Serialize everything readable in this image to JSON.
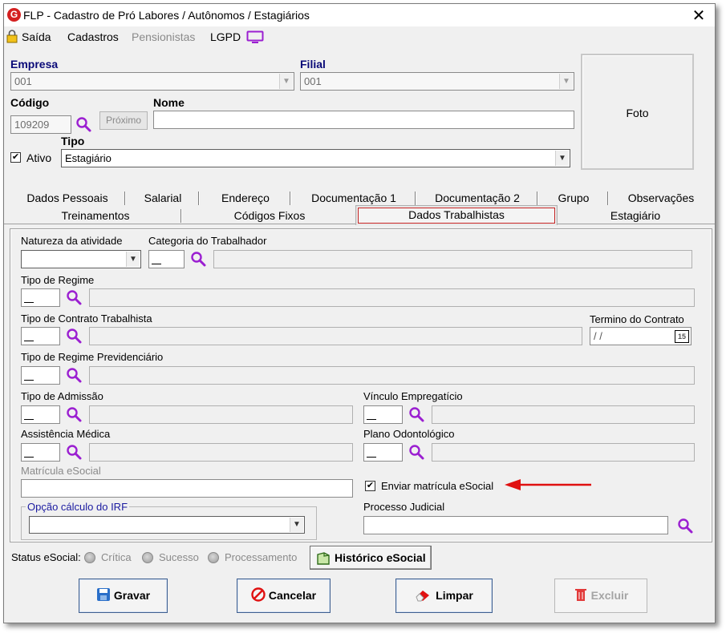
{
  "window": {
    "title": "FLP - Cadastro de Pró Labores / Autônomos / Estagiários",
    "close_label": "✕"
  },
  "menu": {
    "saida": "Saída",
    "cadastros": "Cadastros",
    "pensionistas": "Pensionistas",
    "lgpd": "LGPD"
  },
  "header": {
    "empresa_label": "Empresa",
    "empresa_value": "001",
    "filial_label": "Filial",
    "filial_value": "001",
    "codigo_label": "Código",
    "codigo_value": "109209",
    "proximo_label": "Próximo",
    "nome_label": "Nome",
    "nome_value": "",
    "ativo_label": "Ativo",
    "ativo_checked": true,
    "tipo_label": "Tipo",
    "tipo_value": "Estagiário",
    "foto_label": "Foto"
  },
  "tabs": {
    "row1": [
      "Dados Pessoais",
      "Salarial",
      "Endereço",
      "Documentação 1",
      "Documentação 2",
      "Grupo",
      "Observações"
    ],
    "row2": [
      "Treinamentos",
      "Códigos Fixos",
      "Dados Trabalhistas",
      "Estagiário"
    ],
    "active": "Dados Trabalhistas"
  },
  "form": {
    "natureza_label": "Natureza da atividade",
    "categoria_label": "Categoria do Trabalhador",
    "tipo_regime_label": "Tipo de Regime",
    "tipo_contrato_label": "Tipo de Contrato Trabalhista",
    "termino_label": "Termino do Contrato",
    "termino_value": "/ /",
    "calendar_label": "15",
    "regime_prev_label": "Tipo de Regime Previdenciário",
    "tipo_admissao_label": "Tipo de Admissão",
    "vinculo_label": "Vínculo Empregatício",
    "assistencia_label": "Assistência Médica",
    "plano_odonto_label": "Plano Odontológico",
    "matricula_label": "Matrícula eSocial",
    "enviar_matricula_label": "Enviar matrícula eSocial",
    "enviar_matricula_checked": true,
    "opcao_irf_label": "Opção cálculo do IRF",
    "processo_judicial_label": "Processo Judicial"
  },
  "status": {
    "label": "Status eSocial:",
    "critica": "Crítica",
    "sucesso": "Sucesso",
    "processamento": "Processamento",
    "historico_label": "Histórico eSocial"
  },
  "actions": {
    "gravar": "Gravar",
    "cancelar": "Cancelar",
    "limpar": "Limpar",
    "excluir": "Excluir"
  },
  "colors": {
    "accent_purple": "#9b1fd1",
    "annotation_red": "#e01010",
    "label_blue": "#0a0a78",
    "save_blue": "#2a6fc9"
  }
}
